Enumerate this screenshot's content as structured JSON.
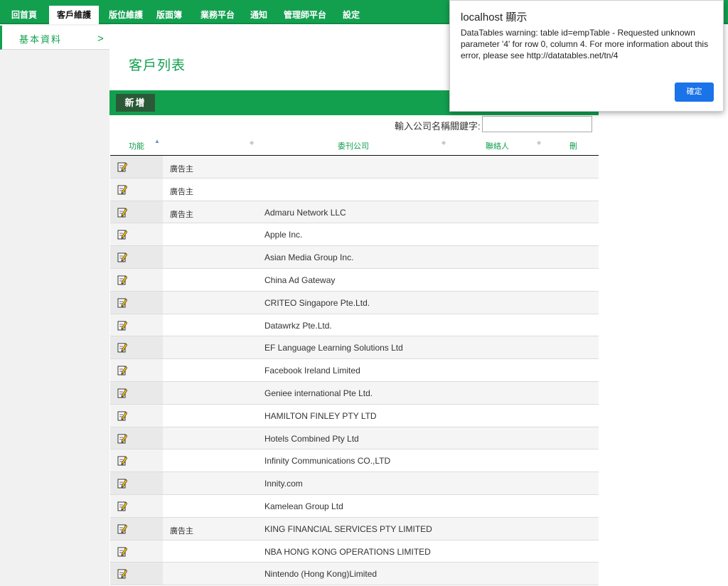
{
  "nav": {
    "items": [
      {
        "label": "回首頁",
        "active": false
      },
      {
        "label": "客戶維護",
        "active": true
      },
      {
        "label": "版位維護",
        "active": false
      },
      {
        "label": "版面簿",
        "active": false
      },
      {
        "label": "業務平台",
        "active": false
      },
      {
        "label": "通知",
        "active": false
      },
      {
        "label": "管理師平台",
        "active": false
      },
      {
        "label": "設定",
        "active": false
      }
    ]
  },
  "sidebar": {
    "items": [
      {
        "label": "基本資料",
        "arrow": ">"
      }
    ]
  },
  "main": {
    "title": "客戶列表",
    "add_label": "新增",
    "search_label": "輸入公司名稱關鍵字:",
    "search_value": ""
  },
  "table": {
    "headers": [
      "功能",
      "",
      "委刊公司",
      "聯絡人",
      "刪"
    ],
    "rows": [
      {
        "type": "廣告主",
        "company": ""
      },
      {
        "type": "廣告主",
        "company": ""
      },
      {
        "type": "廣告主",
        "company": "Admaru Network LLC"
      },
      {
        "type": "",
        "company": "Apple Inc."
      },
      {
        "type": "",
        "company": "Asian Media Group Inc."
      },
      {
        "type": "",
        "company": "China Ad Gateway"
      },
      {
        "type": "",
        "company": "CRITEO Singapore Pte.Ltd."
      },
      {
        "type": "",
        "company": "Datawrkz Pte.Ltd."
      },
      {
        "type": "",
        "company": "EF Language Learning Solutions Ltd"
      },
      {
        "type": "",
        "company": "Facebook Ireland Limited"
      },
      {
        "type": "",
        "company": "Geniee international Pte Ltd."
      },
      {
        "type": "",
        "company": "HAMILTON FINLEY PTY LTD"
      },
      {
        "type": "",
        "company": "Hotels Combined Pty Ltd"
      },
      {
        "type": "",
        "company": "Infinity Communications CO.,LTD"
      },
      {
        "type": "",
        "company": "Innity.com"
      },
      {
        "type": "",
        "company": "Kamelean Group Ltd"
      },
      {
        "type": "廣告主",
        "company": "KING FINANCIAL SERVICES PTY LIMITED"
      },
      {
        "type": "",
        "company": "NBA HONG KONG OPERATIONS LIMITED"
      },
      {
        "type": "",
        "company": "Nintendo (Hong Kong)Limited"
      }
    ]
  },
  "dialog": {
    "title": "localhost 顯示",
    "message": "DataTables warning: table id=empTable - Requested unknown parameter '4' for row 0, column 4. For more information about this error, please see http://datatables.net/tn/4",
    "ok_label": "確定"
  },
  "colors": {
    "brand_green": "#12a04f",
    "dark_green_button": "#2b5937",
    "dialog_button_blue": "#1a73e8"
  }
}
